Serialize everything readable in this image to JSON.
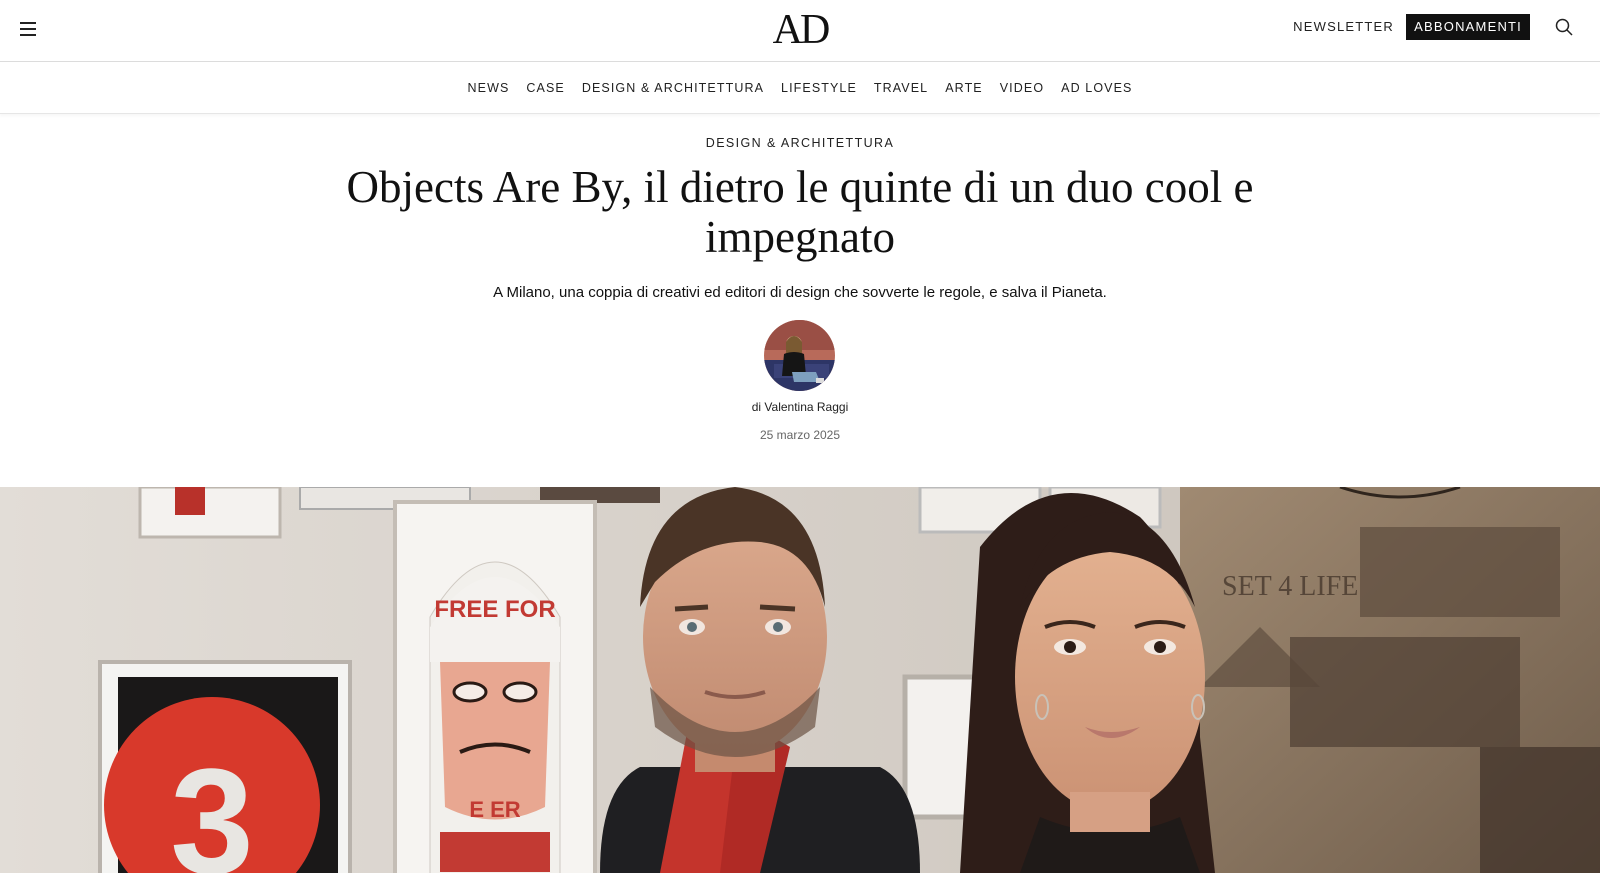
{
  "header": {
    "logo": "AD",
    "newsletter_label": "NEWSLETTER",
    "subscribe_label": "ABBONAMENTI"
  },
  "nav": {
    "items": [
      {
        "label": "NEWS"
      },
      {
        "label": "CASE"
      },
      {
        "label": "DESIGN & ARCHITETTURA"
      },
      {
        "label": "LIFESTYLE"
      },
      {
        "label": "TRAVEL"
      },
      {
        "label": "ARTE"
      },
      {
        "label": "VIDEO"
      },
      {
        "label": "AD LOVES"
      }
    ]
  },
  "article": {
    "rubric": "DESIGN & ARCHITETTURA",
    "title": "Objects Are By, il dietro le quinte di un duo cool e impegnato",
    "dek": "A Milano, una coppia di creativi ed editori di design che sovverte le regole, e salva il Pianeta.",
    "byline": "di Valentina Raggi",
    "date": "25 marzo 2025"
  },
  "hero": {
    "frame_letters": "FREE FOR",
    "frame_letters_2": "E ER",
    "sign_number": "3",
    "wall_text": "SET 4 LIFE"
  },
  "icons": {
    "menu": "hamburger-menu-icon",
    "search": "search-icon"
  },
  "colors": {
    "subscribe_bg": "#111111",
    "accent_red": "#d8392b"
  }
}
